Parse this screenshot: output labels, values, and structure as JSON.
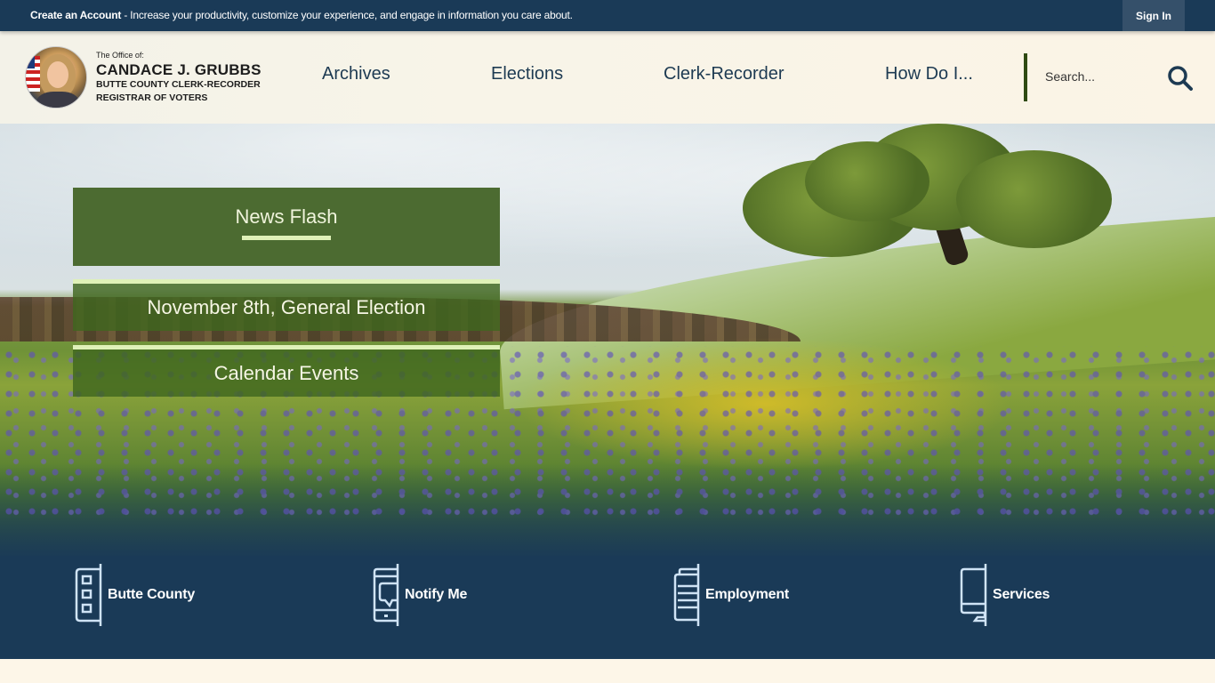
{
  "topbar": {
    "promo_bold": "Create an Account",
    "promo_rest": " - Increase your productivity, customize your experience, and engage in information you care about.",
    "sign_in": "Sign In"
  },
  "logo": {
    "office": "The Office of:",
    "name": "CANDACE J. GRUBBS",
    "line1": "BUTTE COUNTY CLERK-RECORDER",
    "line2": "REGISTRAR OF VOTERS"
  },
  "nav": {
    "items": [
      {
        "label": "Archives"
      },
      {
        "label": "Elections"
      },
      {
        "label": "Clerk-Recorder"
      },
      {
        "label": "How Do I..."
      }
    ]
  },
  "search": {
    "placeholder": "Search...",
    "value": "",
    "icon": "search-icon"
  },
  "hero": {
    "news_flash": "News Flash",
    "links": [
      {
        "label": "November 8th, General Election"
      },
      {
        "label": "Calendar Events"
      }
    ]
  },
  "quicklinks": {
    "items": [
      {
        "label": "Butte County",
        "icon": "building-icon"
      },
      {
        "label": "Notify Me",
        "icon": "phone-message-icon"
      },
      {
        "label": "Employment",
        "icon": "document-icon"
      },
      {
        "label": "Services",
        "icon": "computer-icon"
      }
    ]
  },
  "colors": {
    "navy": "#1a3a57",
    "green": "#4c6b31",
    "accent_light": "#dff1b8",
    "cream": "#fdf6e8"
  }
}
